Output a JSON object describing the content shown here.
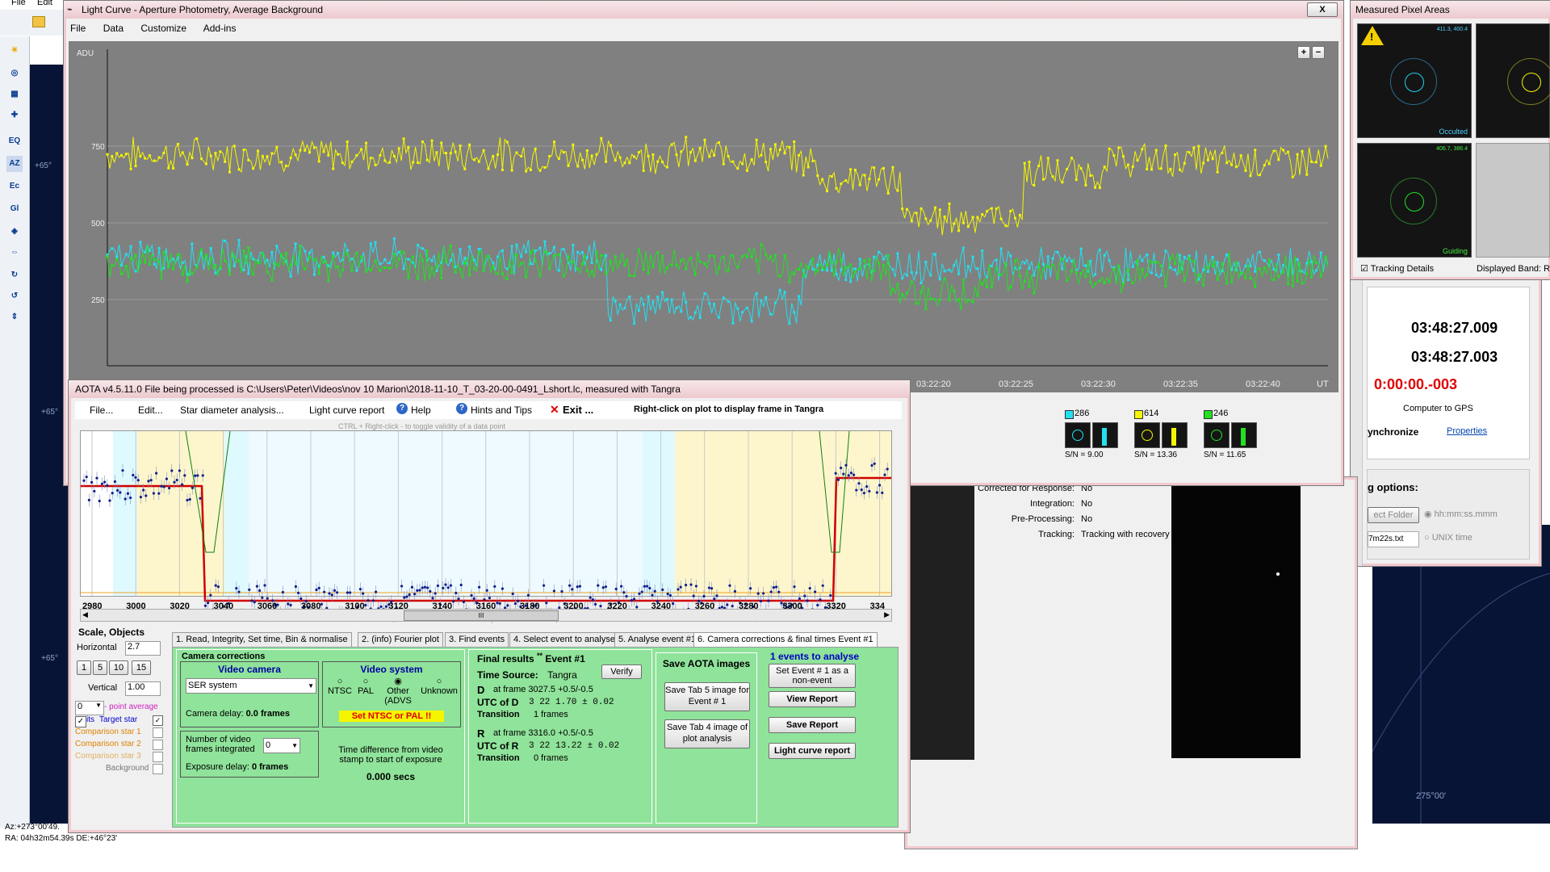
{
  "desktop": {
    "menu_file": "File",
    "menu_edit": "Edit",
    "tools": [
      "EQ",
      "AZ",
      "Ec",
      "Gl"
    ],
    "status_az": "Az:+273°00'49.",
    "status_ra": "RA: 04h32m54.39s DE:+46°23'",
    "sky_labels": [
      "+65°",
      "+65°",
      "+65°",
      "275°00'"
    ]
  },
  "lightcurve": {
    "title": "Light Curve - Aperture Photometry, Average Background",
    "menu": [
      "File",
      "Data",
      "Customize",
      "Add-ins"
    ],
    "y_unit": "ADU",
    "y_ticks": [
      "750",
      "500",
      "250"
    ],
    "x_ticks": [
      "03:22:20",
      "03:22:25",
      "03:22:30",
      "03:22:35",
      "03:22:40"
    ],
    "x_unit": "UT",
    "zoom_in": "+",
    "zoom_out": "−",
    "close": "X",
    "stars": [
      {
        "id": "286",
        "sn_label": "S/N =",
        "sn": "9.00",
        "color": "#22e0f0"
      },
      {
        "id": "614",
        "sn_label": "S/N =",
        "sn": "13.36",
        "color": "#f5f500"
      },
      {
        "id": "246",
        "sn_label": "S/N =",
        "sn": "11.65",
        "color": "#22e022"
      }
    ]
  },
  "chart_data": {
    "type": "line",
    "ylabel": "ADU",
    "y_ticks": [
      250,
      500,
      750
    ],
    "x_ticks": [
      "03:22:20",
      "03:22:25",
      "03:22:30",
      "03:22:35",
      "03:22:40"
    ],
    "series": [
      {
        "name": "614",
        "color": "#f5f500",
        "segments": [
          [
            0,
            0.56,
            640
          ],
          [
            0.58,
            0.65,
            560
          ],
          [
            0.65,
            0.7,
            420
          ],
          [
            0.7,
            0.75,
            430
          ],
          [
            0.75,
            0.82,
            580
          ],
          [
            0.82,
            1,
            620
          ]
        ]
      },
      {
        "name": "286",
        "color": "#22e0f0",
        "segments": [
          [
            0,
            0.41,
            290
          ],
          [
            0.41,
            0.57,
            120
          ],
          [
            0.57,
            1,
            265
          ]
        ]
      },
      {
        "name": "246",
        "color": "#22e022",
        "segments": [
          [
            0,
            0.55,
            270
          ],
          [
            0.55,
            0.64,
            260
          ],
          [
            0.64,
            0.72,
            170
          ],
          [
            0.72,
            0.85,
            230
          ],
          [
            0.85,
            1,
            250
          ]
        ]
      }
    ]
  },
  "pixel": {
    "title": "Measured Pixel Areas",
    "thumbs": [
      {
        "label": "Occulted",
        "coords": "411.3, 400.4"
      },
      {
        "label": "",
        "coords": ""
      },
      {
        "label": "Guiding",
        "coords": "406.7, 386.4"
      }
    ],
    "tracking": "Tracking Details",
    "band": "Displayed Band: Re"
  },
  "timer": {
    "t1": "03:48:27.009",
    "t2": "03:48:27.003",
    "diff": "0:00:00.-003",
    "computer_to_gps": "Computer to GPS",
    "synchronize": "ynchronize",
    "properties": "Properties",
    "options": "g options:",
    "folder": "ect Folder",
    "format1": "hh:mm:ss.mmm",
    "format2": "UNIX time",
    "file": "7m22s.txt"
  },
  "info": {
    "rows": [
      {
        "k": "Corrected for Response:",
        "v": "No"
      },
      {
        "k": "Integration:",
        "v": "No"
      },
      {
        "k": "Pre-Processing:",
        "v": "No"
      },
      {
        "k": "Tracking:",
        "v": "Tracking with recovery"
      }
    ]
  },
  "aota": {
    "title": "AOTA v4.5.11.0    File being processed is C:\\Users\\Peter\\Videos\\nov 10 Marion\\2018-11-10_T_03-20-00-0491_Lshort.lc, measured with Tangra",
    "menu": [
      "File...",
      "Edit...",
      "Star diameter analysis...",
      "Light curve report",
      "Help",
      "Hints and Tips"
    ],
    "exit": "Exit ...",
    "right_click": "Right-click on plot to display frame in Tangra",
    "ctrl_hint": "CTRL + Right-click  -  to toggle validity of a data point",
    "x_ticks": [
      "2980",
      "3000",
      "3020",
      "3040",
      "3060",
      "3080",
      "3100",
      "3120",
      "3140",
      "3160",
      "3180",
      "3200",
      "3220",
      "3240",
      "3260",
      "3280",
      "3300",
      "3320",
      "334"
    ],
    "scroll_grip": "III",
    "scale_title": "Scale,  Objects",
    "horizontal": "Horizontal",
    "h_val": "2.7",
    "h_btns": [
      "1",
      "5",
      "10",
      "15"
    ],
    "vertical": "Vertical",
    "v_val": "1.00",
    "avg_val": "0",
    "avg_label": "- point average",
    "target": "Target star",
    "target_prefix": "its",
    "comp1": "Comparison star 1",
    "comp2": "Comparison star 2",
    "comp3": "Comparison star 3",
    "background": "Background",
    "tabs": [
      "1. Read, Integrity, Set time, Bin & normalise",
      "2. (info) Fourier plot",
      "3. Find events",
      "4. Select event to analyse",
      "5. Analyse event #1",
      "6. Camera corrections & final times Event #1"
    ],
    "camcorr": "Camera corrections",
    "video_camera": "Video camera",
    "camera_value": "SER system",
    "camera_delay": "Camera delay: ",
    "camera_delay_val": "0.0 frames",
    "frames_int": "Number of video frames integrated",
    "frames_int_val": "0",
    "exposure_delay": "Exposure delay: ",
    "exposure_delay_val": "0 frames",
    "video_system": "Video system",
    "vs_opts": [
      "NTSC",
      "PAL",
      "Other (ADVS",
      "Unknown"
    ],
    "set_ntsc": "Set NTSC or PAL !!",
    "timediff": "Time difference from video stamp to start of exposure",
    "timediff_val": "0.000 secs",
    "final_results": "Final results",
    "event": "Event #1",
    "verify": "Verify",
    "time_source": "Time Source:",
    "time_source_val": "Tangra",
    "d_label": "D",
    "d_frame": "at frame 3027.5  +0.5/-0.5",
    "utc_d": "UTC of D",
    "utc_d_val": "3  22   1.70  ± 0.02",
    "transition": "Transition",
    "d_trans": "1 frames",
    "r_label": "R",
    "r_frame": "at frame 3316.0  +0.5/-0.5",
    "utc_r": "UTC of R",
    "utc_r_val": "3  22  13.22  ± 0.02",
    "r_trans": "0 frames",
    "save_title": "Save AOTA images",
    "save5": "Save Tab 5 image for Event # 1",
    "save4": "Save Tab 4 image of plot analysis",
    "events": "1  events to analyse",
    "set_event": "Set Event # 1 as a non-event",
    "view_report": "View Report",
    "save_report": "Save Report",
    "lc_report": "Light curve report"
  }
}
